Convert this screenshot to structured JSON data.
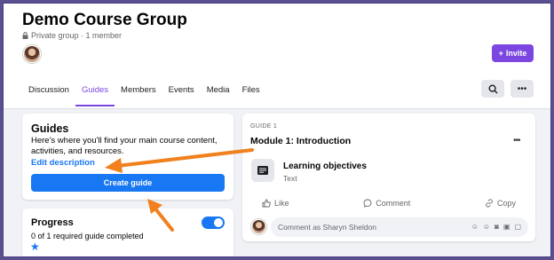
{
  "header": {
    "title": "Demo Course Group",
    "subtitle": "Private group · 1 member",
    "invite_label": "Invite"
  },
  "tabs": [
    {
      "label": "Discussion",
      "active": false
    },
    {
      "label": "Guides",
      "active": true
    },
    {
      "label": "Members",
      "active": false
    },
    {
      "label": "Events",
      "active": false
    },
    {
      "label": "Media",
      "active": false
    },
    {
      "label": "Files",
      "active": false
    }
  ],
  "guides_card": {
    "title": "Guides",
    "description": "Here's where you'll find your main course content, activities, and resources.",
    "edit_link": "Edit description",
    "create_button": "Create guide"
  },
  "progress_card": {
    "title": "Progress",
    "text": "0 of 1 required guide completed",
    "toggle_on": true
  },
  "module_card": {
    "guide_label": "GUIDE 1",
    "title": "Module 1: Introduction",
    "item_title": "Learning objectives",
    "item_type": "Text",
    "like_label": "Like",
    "comment_label": "Comment",
    "copy_label": "Copy",
    "comment_placeholder": "Comment as Sharyn Sheldon"
  },
  "colors": {
    "accent_purple": "#7b47e0",
    "primary_blue": "#1877f2",
    "annotation_orange": "#f0811e"
  }
}
